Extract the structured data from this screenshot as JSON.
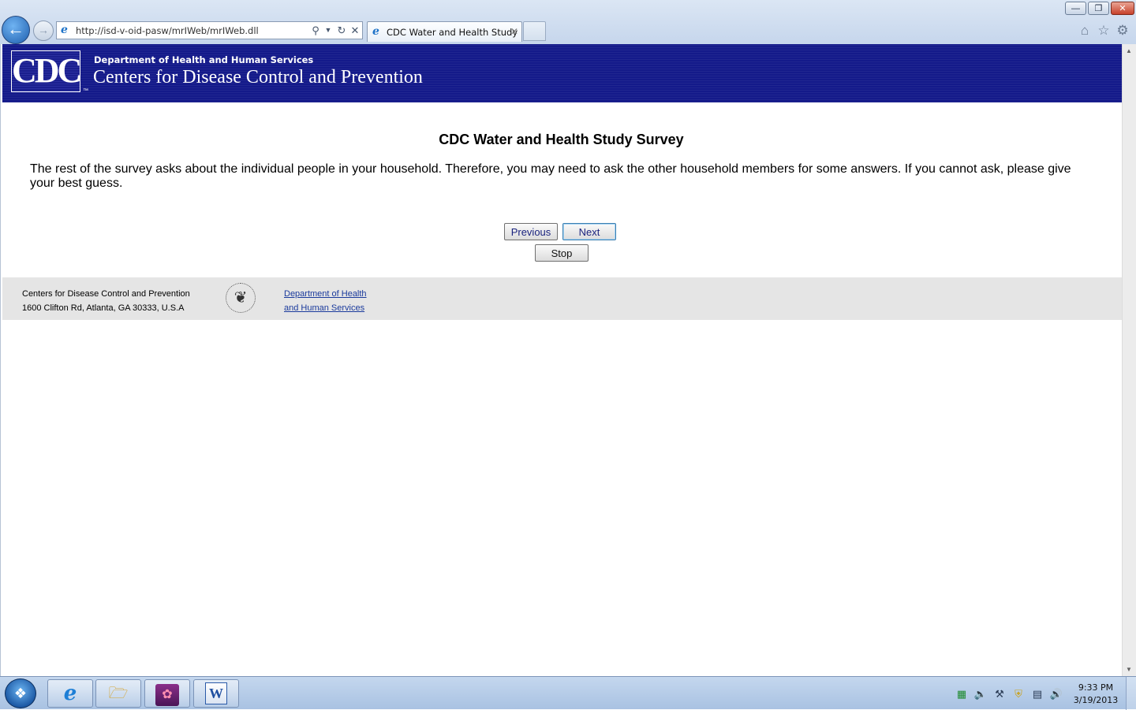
{
  "browser": {
    "url": "http://isd-v-oid-pasw/mrIWeb/mrIWeb.dll",
    "tab_title": "CDC Water and Health Study",
    "window_buttons": [
      "minimize",
      "restore",
      "close"
    ],
    "toolbar_icons": [
      "home-icon",
      "favorites-icon",
      "tools-gear-icon"
    ]
  },
  "header": {
    "logo_text": "CDC",
    "trademark": "™",
    "department": "Department of Health and Human Services",
    "agency": "Centers for Disease Control and Prevention",
    "background_color": "#141a8a"
  },
  "survey": {
    "title": "CDC Water and Health Study Survey",
    "intro": "The rest of the survey asks about the individual people in your household. Therefore, you may need to ask the other household members for some answers. If you cannot ask, please give your best guess.",
    "buttons": {
      "previous": "Previous",
      "next": "Next",
      "stop": "Stop"
    }
  },
  "footer": {
    "org_line1": "Centers for Disease Control and Prevention",
    "org_line2": "1600 Clifton Rd, Atlanta, GA 30333, U.S.A",
    "link_line1": "Department of Health",
    "link_line2": "and Human Services",
    "link_color": "#1a3a9c"
  },
  "taskbar": {
    "pinned_apps": [
      "internet-explorer-icon",
      "windows-explorer-icon",
      "app-icon",
      "word-icon"
    ],
    "word_letter": "W",
    "clock_time": "9:33 PM",
    "clock_date": "3/19/2013"
  }
}
